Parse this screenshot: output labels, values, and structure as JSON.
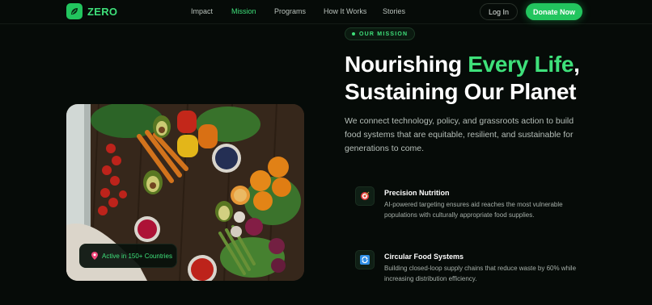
{
  "brand": {
    "name": "ZERO",
    "icon": "leaf-logo-icon",
    "color": "#22c55e"
  },
  "nav": {
    "links": [
      {
        "label": "Impact",
        "active": false
      },
      {
        "label": "Mission",
        "active": true
      },
      {
        "label": "Programs",
        "active": false
      },
      {
        "label": "How It Works",
        "active": false
      },
      {
        "label": "Stories",
        "active": false
      }
    ],
    "login_label": "Log In",
    "donate_label": "Donate Now"
  },
  "hero": {
    "eyebrow": "OUR MISSION",
    "headline_part1": "Nourishing ",
    "headline_accent": "Every Life",
    "headline_part2": ",",
    "headline_line2": "Sustaining Our Planet",
    "lead": "We connect technology, policy, and grassroots action to build food systems that are equitable, resilient, and sustainable for generations to come.",
    "image_alt_icon": "vegetables-photo",
    "badge": {
      "icon": "location-pin-icon",
      "text": "Active in 150+ Countries"
    }
  },
  "features": [
    {
      "icon": "target-icon",
      "title": "Precision Nutrition",
      "description": "AI-powered targeting ensures aid reaches the most vulnerable populations with culturally appropriate food supplies."
    },
    {
      "icon": "recycle-icon",
      "title": "Circular Food Systems",
      "description": "Building closed-loop supply chains that reduce waste by 60% while increasing distribution efficiency."
    }
  ],
  "colors": {
    "accent": "#3ee07a",
    "background": "#060b08",
    "button": "#22c55e"
  }
}
